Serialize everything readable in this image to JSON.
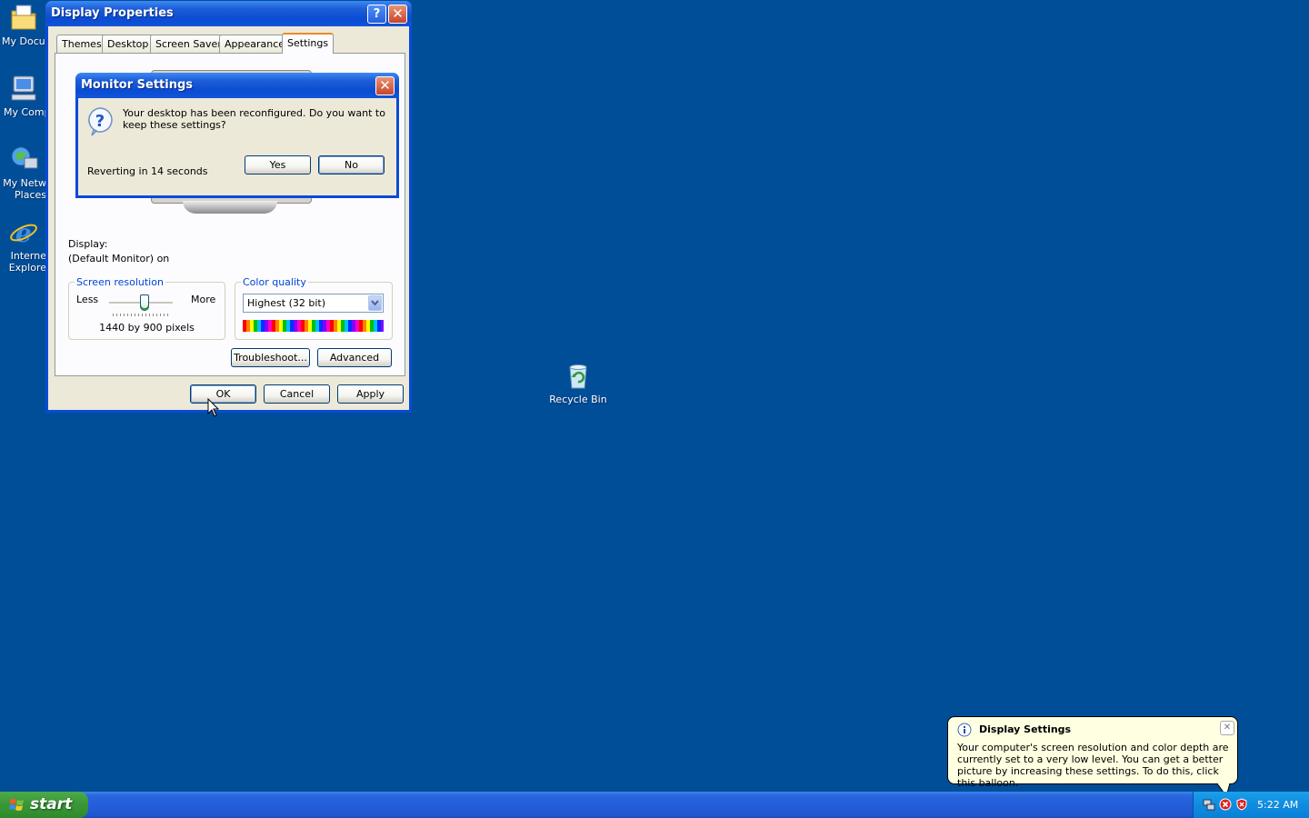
{
  "desktop": {
    "icons": [
      {
        "label": "My Docum"
      },
      {
        "label": "My Compu"
      },
      {
        "label": "My Netw Places"
      },
      {
        "label": "Interne Explore"
      },
      {
        "label": "Recycle Bin"
      }
    ]
  },
  "display_properties": {
    "title": "Display Properties",
    "help_symbol": "?",
    "close_symbol": "✕",
    "tabs": [
      {
        "label": "Themes"
      },
      {
        "label": "Desktop"
      },
      {
        "label": "Screen Saver"
      },
      {
        "label": "Appearance"
      },
      {
        "label": "Settings",
        "active": true
      }
    ],
    "display_label": "Display:",
    "display_value": "(Default Monitor) on",
    "screen_resolution": {
      "group_label": "Screen resolution",
      "less": "Less",
      "more": "More",
      "value": "1440 by 900 pixels",
      "slider_level": 0.55
    },
    "color_quality": {
      "group_label": "Color quality",
      "selected": "Highest (32 bit)"
    },
    "troubleshoot_button": "Troubleshoot...",
    "advanced_button": "Advanced",
    "ok_button": "OK",
    "cancel_button": "Cancel",
    "apply_button": "Apply"
  },
  "monitor_settings": {
    "title": "Monitor Settings",
    "message": "Your desktop has been reconfigured.  Do you want to keep these settings?",
    "countdown": "Reverting in 14 seconds",
    "yes_button": "Yes",
    "no_button": "No",
    "close_symbol": "✕"
  },
  "balloon": {
    "title": "Display Settings",
    "body": "Your computer's screen resolution and color depth are currently set to a very low level. You can get a better picture by increasing these settings. To do this, click this balloon.",
    "close_symbol": "✕"
  },
  "taskbar": {
    "start_label": "start",
    "clock": "5:22 AM"
  },
  "colors": {
    "desktop": "#004e98",
    "titlebar": "#0a4cd2",
    "window_face": "#ece9d8",
    "start_green": "#3c9a3a",
    "tray_blue": "#0f8ce0",
    "balloon_bg": "#ffffe1"
  }
}
